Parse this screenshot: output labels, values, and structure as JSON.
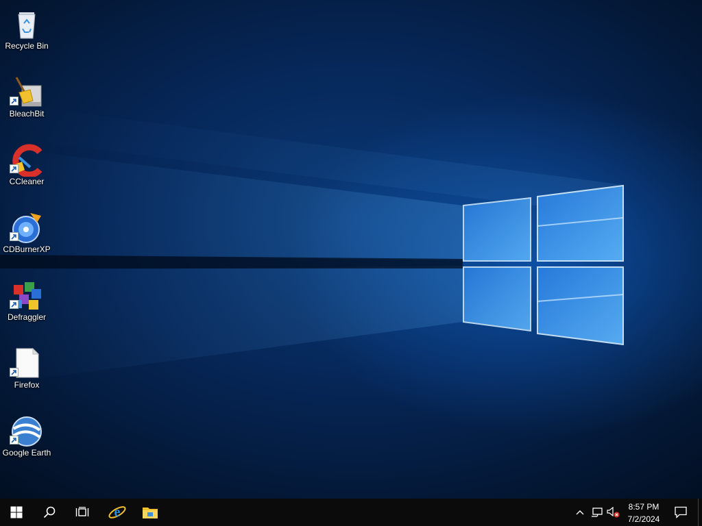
{
  "desktop": {
    "icons": [
      {
        "label": "Recycle Bin",
        "icon": "recycle-bin-icon"
      },
      {
        "label": "BleachBit",
        "icon": "bleachbit-icon"
      },
      {
        "label": "CCleaner",
        "icon": "ccleaner-icon"
      },
      {
        "label": "CDBurnerXP",
        "icon": "cdburnerxp-icon"
      },
      {
        "label": "Defraggler",
        "icon": "defraggler-icon"
      },
      {
        "label": "Firefox",
        "icon": "blank-file-icon"
      },
      {
        "label": "Google Earth",
        "icon": "google-earth-icon"
      }
    ]
  },
  "taskbar": {
    "start": "windows-start-icon",
    "search": "search-icon",
    "task_view": "task-view-icon",
    "pinned": [
      "internet-explorer-icon",
      "file-explorer-icon"
    ],
    "tray": [
      "chevron-up-icon",
      "network-icon",
      "volume-muted-icon"
    ],
    "clock": {
      "time": "8:57 PM",
      "date": "7/2/2024"
    },
    "notifications": "action-center-icon"
  },
  "colors": {
    "taskbar": "#0b0b0b",
    "accent": "#1a8cff"
  }
}
